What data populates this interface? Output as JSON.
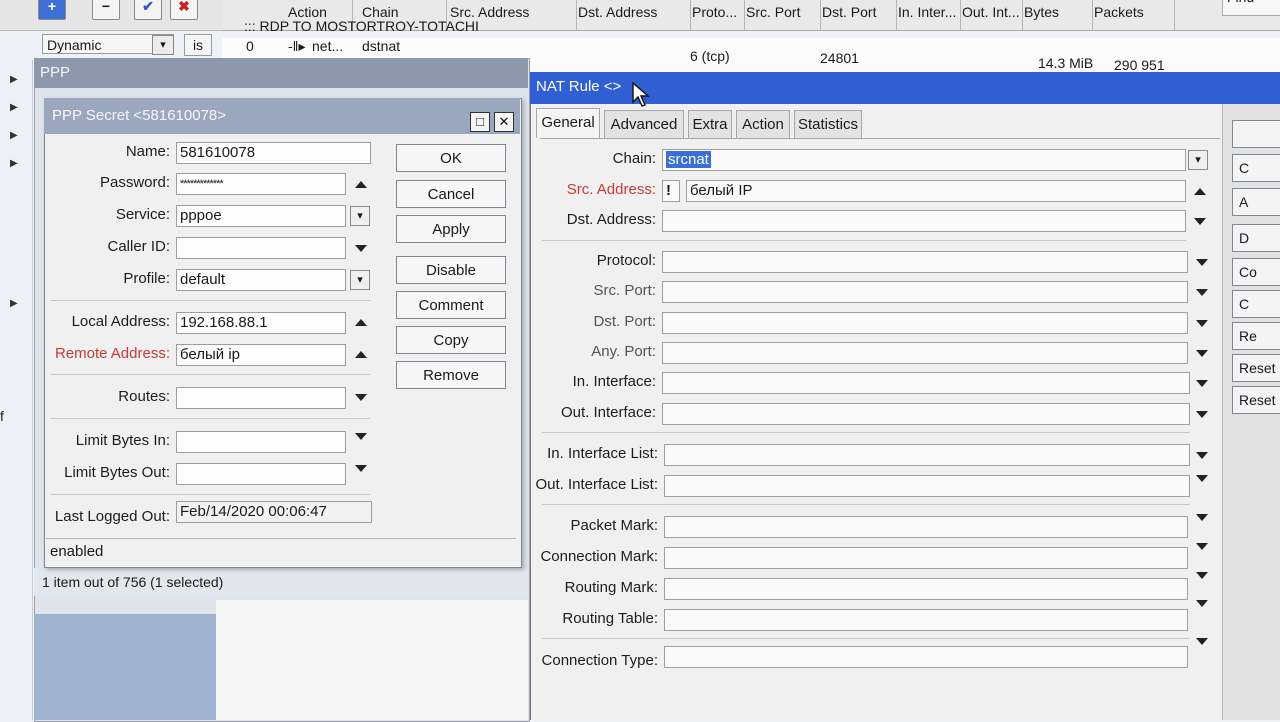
{
  "top_list": {
    "columns": [
      "Action",
      "Chain",
      "Src. Address",
      "Dst. Address",
      "Proto...",
      "Src. Port",
      "Dst. Port",
      "In. Inter...",
      "Out. Int...",
      "Bytes",
      "Packets"
    ],
    "comment_row": "::: RDP TO MOSTORTROY-TOTACHI",
    "row": {
      "index": "0",
      "action": "net...",
      "chain": "dstnat",
      "proto": "6 (tcp)",
      "dst_port": "24801",
      "bytes": "14.3 MiB",
      "packets": "290 951"
    },
    "filter_value": "Dynamic",
    "filter_op": "is",
    "find_label": "Find"
  },
  "ppp_window": {
    "title": "PPP",
    "status": "1 item out of 756 (1 selected)"
  },
  "secret_dialog": {
    "title": "PPP Secret <581610078>",
    "fields": {
      "name": {
        "label": "Name:",
        "value": "581610078"
      },
      "password": {
        "label": "Password:",
        "value": "*************"
      },
      "service": {
        "label": "Service:",
        "value": "pppoe"
      },
      "caller_id": {
        "label": "Caller ID:",
        "value": ""
      },
      "profile": {
        "label": "Profile:",
        "value": "default"
      },
      "local_address": {
        "label": "Local Address:",
        "value": "192.168.88.1"
      },
      "remote_address": {
        "label": "Remote Address:",
        "value": "белый ip"
      },
      "routes": {
        "label": "Routes:",
        "value": ""
      },
      "limit_in": {
        "label": "Limit Bytes In:",
        "value": ""
      },
      "limit_out": {
        "label": "Limit Bytes Out:",
        "value": ""
      },
      "last_logged_out": {
        "label": "Last Logged Out:",
        "value": "Feb/14/2020 00:06:47"
      }
    },
    "buttons": {
      "ok": "OK",
      "cancel": "Cancel",
      "apply": "Apply",
      "disable": "Disable",
      "comment": "Comment",
      "copy": "Copy",
      "remove": "Remove"
    },
    "status": "enabled"
  },
  "nat_dialog": {
    "title": "NAT Rule <>",
    "tabs": [
      "General",
      "Advanced",
      "Extra",
      "Action",
      "Statistics"
    ],
    "fields": {
      "chain": {
        "label": "Chain:",
        "value": "srcnat"
      },
      "src_address": {
        "label": "Src. Address:",
        "value": "белый IP",
        "negate": "!"
      },
      "dst_address": {
        "label": "Dst. Address:",
        "value": ""
      },
      "protocol": {
        "label": "Protocol:",
        "value": ""
      },
      "src_port": {
        "label": "Src. Port:",
        "value": ""
      },
      "dst_port": {
        "label": "Dst. Port:",
        "value": ""
      },
      "any_port": {
        "label": "Any. Port:",
        "value": ""
      },
      "in_interface": {
        "label": "In. Interface:",
        "value": ""
      },
      "out_interface": {
        "label": "Out. Interface:",
        "value": ""
      },
      "in_interface_list": {
        "label": "In. Interface List:",
        "value": ""
      },
      "out_interface_list": {
        "label": "Out. Interface List:",
        "value": ""
      },
      "packet_mark": {
        "label": "Packet Mark:",
        "value": ""
      },
      "connection_mark": {
        "label": "Connection Mark:",
        "value": ""
      },
      "routing_mark": {
        "label": "Routing Mark:",
        "value": ""
      },
      "routing_table": {
        "label": "Routing Table:",
        "value": ""
      },
      "connection_type": {
        "label": "Connection Type:",
        "value": ""
      }
    },
    "side_buttons": [
      "",
      "C",
      "A",
      "D",
      "Co",
      "C",
      "Re",
      "Reset",
      "Reset"
    ]
  },
  "left_strip_text": "f"
}
